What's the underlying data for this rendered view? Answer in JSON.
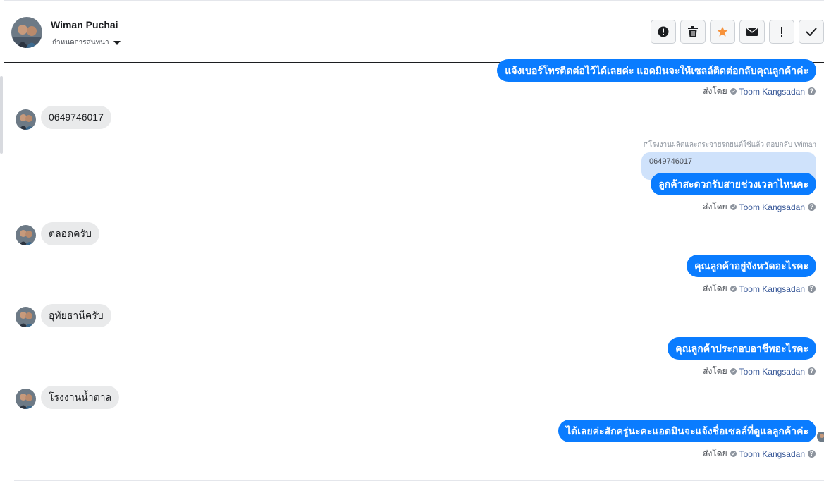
{
  "conversation": {
    "contact_name": "Wiman Puchai",
    "subtitle": "กำหนดการสนทนา"
  },
  "actions": [
    {
      "name": "spam-button",
      "icon": "alert-circle-icon"
    },
    {
      "name": "delete-button",
      "icon": "trash-icon"
    },
    {
      "name": "star-button",
      "icon": "star-icon",
      "color": "#f7923b"
    },
    {
      "name": "mark-unread-button",
      "icon": "envelope-icon"
    },
    {
      "name": "follow-up-button",
      "icon": "exclamation-icon"
    },
    {
      "name": "mark-done-button",
      "icon": "check-icon"
    }
  ],
  "messages": {
    "out1": {
      "text": "แจ้งเบอร์โทรติดต่อไว้ได้เลยค่ะ แอดมินจะให้เซลล์ติดต่อกลับคุณลูกค้าค่ะ",
      "sent_by_label": "ส่งโดย",
      "agent": "Toom Kangsadan"
    },
    "in1": {
      "text": "0649746017"
    },
    "reply_note": "↱โรงงานผลิตและกระจายรถยนต์ใช้แล้ว ตอบกลับ Wiman",
    "quoted_text": "0649746017",
    "out2": {
      "text": "ลูกค้าสะดวกรับสายช่วงเวลาไหนคะ",
      "sent_by_label": "ส่งโดย",
      "agent": "Toom Kangsadan"
    },
    "in2": {
      "text": "ตลอดครับ"
    },
    "out3": {
      "text": "คุณลูกค้าอยู่จังหวัดอะไรคะ",
      "sent_by_label": "ส่งโดย",
      "agent": "Toom Kangsadan"
    },
    "in3": {
      "text": "อุทัยธานีครับ"
    },
    "out4": {
      "text": "คุณลูกค้าประกอบอาชีพอะไรคะ",
      "sent_by_label": "ส่งโดย",
      "agent": "Toom Kangsadan"
    },
    "in4": {
      "text": "โรงงานน้ำตาล"
    },
    "out5": {
      "text": "ได้เลยค่ะสักครู่นะคะแอดมินจะแจ้งชื่อเซลล์ที่ดูแลลูกค้าค่ะ",
      "sent_by_label": "ส่งโดย",
      "agent": "Toom Kangsadan"
    }
  },
  "colors": {
    "outgoing_bubble": "#0a7cff",
    "incoming_bubble": "#e9eaeb",
    "quoted_bubble": "#cfe2fb",
    "agent_link": "#385898"
  }
}
